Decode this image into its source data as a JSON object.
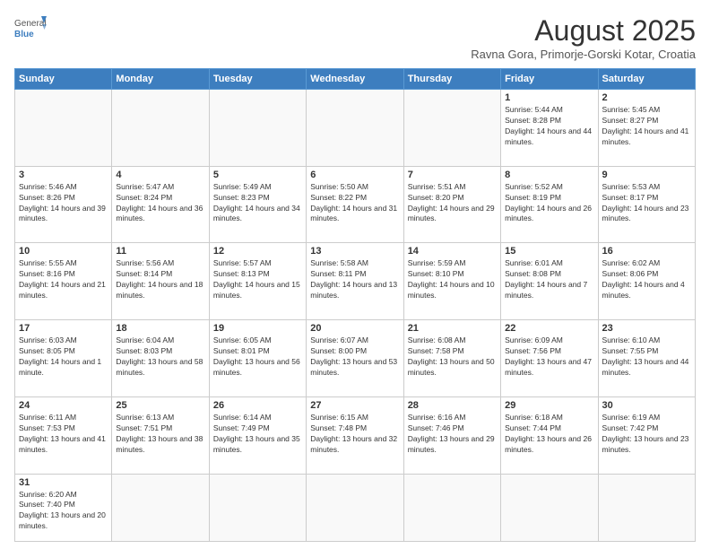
{
  "logo": {
    "text_general": "General",
    "text_blue": "Blue"
  },
  "header": {
    "month_title": "August 2025",
    "subtitle": "Ravna Gora, Primorje-Gorski Kotar, Croatia"
  },
  "weekdays": [
    "Sunday",
    "Monday",
    "Tuesday",
    "Wednesday",
    "Thursday",
    "Friday",
    "Saturday"
  ],
  "days": {
    "d1": {
      "num": "1",
      "info": "Sunrise: 5:44 AM\nSunset: 8:28 PM\nDaylight: 14 hours and 44 minutes."
    },
    "d2": {
      "num": "2",
      "info": "Sunrise: 5:45 AM\nSunset: 8:27 PM\nDaylight: 14 hours and 41 minutes."
    },
    "d3": {
      "num": "3",
      "info": "Sunrise: 5:46 AM\nSunset: 8:26 PM\nDaylight: 14 hours and 39 minutes."
    },
    "d4": {
      "num": "4",
      "info": "Sunrise: 5:47 AM\nSunset: 8:24 PM\nDaylight: 14 hours and 36 minutes."
    },
    "d5": {
      "num": "5",
      "info": "Sunrise: 5:49 AM\nSunset: 8:23 PM\nDaylight: 14 hours and 34 minutes."
    },
    "d6": {
      "num": "6",
      "info": "Sunrise: 5:50 AM\nSunset: 8:22 PM\nDaylight: 14 hours and 31 minutes."
    },
    "d7": {
      "num": "7",
      "info": "Sunrise: 5:51 AM\nSunset: 8:20 PM\nDaylight: 14 hours and 29 minutes."
    },
    "d8": {
      "num": "8",
      "info": "Sunrise: 5:52 AM\nSunset: 8:19 PM\nDaylight: 14 hours and 26 minutes."
    },
    "d9": {
      "num": "9",
      "info": "Sunrise: 5:53 AM\nSunset: 8:17 PM\nDaylight: 14 hours and 23 minutes."
    },
    "d10": {
      "num": "10",
      "info": "Sunrise: 5:55 AM\nSunset: 8:16 PM\nDaylight: 14 hours and 21 minutes."
    },
    "d11": {
      "num": "11",
      "info": "Sunrise: 5:56 AM\nSunset: 8:14 PM\nDaylight: 14 hours and 18 minutes."
    },
    "d12": {
      "num": "12",
      "info": "Sunrise: 5:57 AM\nSunset: 8:13 PM\nDaylight: 14 hours and 15 minutes."
    },
    "d13": {
      "num": "13",
      "info": "Sunrise: 5:58 AM\nSunset: 8:11 PM\nDaylight: 14 hours and 13 minutes."
    },
    "d14": {
      "num": "14",
      "info": "Sunrise: 5:59 AM\nSunset: 8:10 PM\nDaylight: 14 hours and 10 minutes."
    },
    "d15": {
      "num": "15",
      "info": "Sunrise: 6:01 AM\nSunset: 8:08 PM\nDaylight: 14 hours and 7 minutes."
    },
    "d16": {
      "num": "16",
      "info": "Sunrise: 6:02 AM\nSunset: 8:06 PM\nDaylight: 14 hours and 4 minutes."
    },
    "d17": {
      "num": "17",
      "info": "Sunrise: 6:03 AM\nSunset: 8:05 PM\nDaylight: 14 hours and 1 minute."
    },
    "d18": {
      "num": "18",
      "info": "Sunrise: 6:04 AM\nSunset: 8:03 PM\nDaylight: 13 hours and 58 minutes."
    },
    "d19": {
      "num": "19",
      "info": "Sunrise: 6:05 AM\nSunset: 8:01 PM\nDaylight: 13 hours and 56 minutes."
    },
    "d20": {
      "num": "20",
      "info": "Sunrise: 6:07 AM\nSunset: 8:00 PM\nDaylight: 13 hours and 53 minutes."
    },
    "d21": {
      "num": "21",
      "info": "Sunrise: 6:08 AM\nSunset: 7:58 PM\nDaylight: 13 hours and 50 minutes."
    },
    "d22": {
      "num": "22",
      "info": "Sunrise: 6:09 AM\nSunset: 7:56 PM\nDaylight: 13 hours and 47 minutes."
    },
    "d23": {
      "num": "23",
      "info": "Sunrise: 6:10 AM\nSunset: 7:55 PM\nDaylight: 13 hours and 44 minutes."
    },
    "d24": {
      "num": "24",
      "info": "Sunrise: 6:11 AM\nSunset: 7:53 PM\nDaylight: 13 hours and 41 minutes."
    },
    "d25": {
      "num": "25",
      "info": "Sunrise: 6:13 AM\nSunset: 7:51 PM\nDaylight: 13 hours and 38 minutes."
    },
    "d26": {
      "num": "26",
      "info": "Sunrise: 6:14 AM\nSunset: 7:49 PM\nDaylight: 13 hours and 35 minutes."
    },
    "d27": {
      "num": "27",
      "info": "Sunrise: 6:15 AM\nSunset: 7:48 PM\nDaylight: 13 hours and 32 minutes."
    },
    "d28": {
      "num": "28",
      "info": "Sunrise: 6:16 AM\nSunset: 7:46 PM\nDaylight: 13 hours and 29 minutes."
    },
    "d29": {
      "num": "29",
      "info": "Sunrise: 6:18 AM\nSunset: 7:44 PM\nDaylight: 13 hours and 26 minutes."
    },
    "d30": {
      "num": "30",
      "info": "Sunrise: 6:19 AM\nSunset: 7:42 PM\nDaylight: 13 hours and 23 minutes."
    },
    "d31": {
      "num": "31",
      "info": "Sunrise: 6:20 AM\nSunset: 7:40 PM\nDaylight: 13 hours and 20 minutes."
    }
  }
}
